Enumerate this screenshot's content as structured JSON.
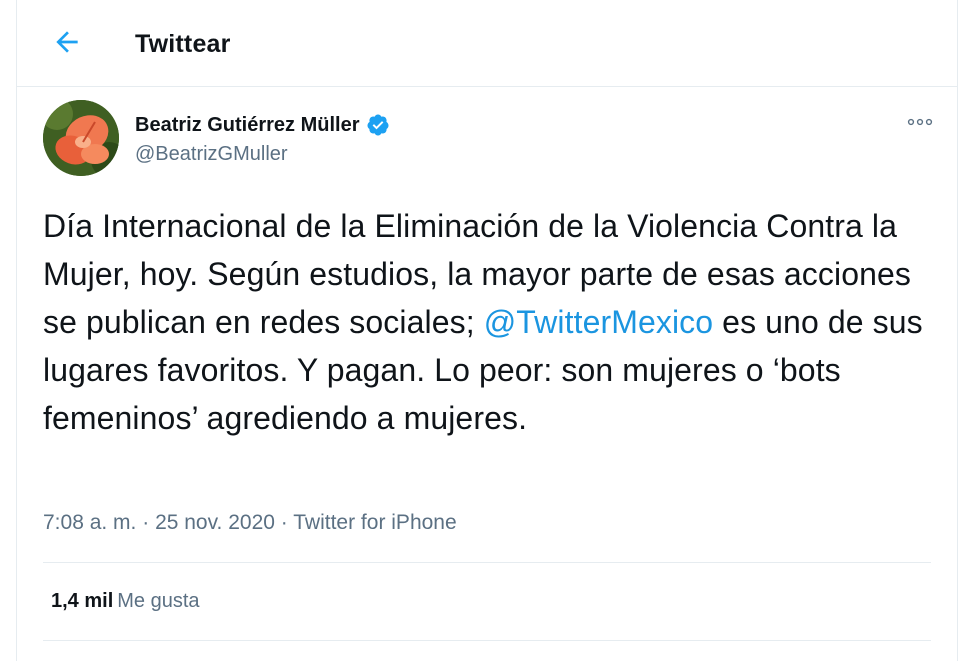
{
  "header": {
    "title": "Twittear",
    "back_icon": "arrow-left-icon"
  },
  "colors": {
    "accent": "#1b95e0",
    "text": "#0f1419",
    "muted": "#5b7083",
    "border": "#e6ecf0",
    "verified": "#1da1f2"
  },
  "tweet": {
    "author": {
      "name": "Beatriz Gutiérrez Müller",
      "handle": "@BeatrizGMuller",
      "verified_icon": "verified-badge-icon"
    },
    "text_part1": "Día Internacional de la Eliminación de la Violencia Contra la Mujer, hoy. Según estudios, la mayor parte de esas acciones se publican en redes sociales; ",
    "mention": "@TwitterMexico",
    "text_part2": " es uno de sus lugares favoritos. Y pagan. Lo peor: son mujeres o ‘bots femeninos’ agrediendo a mujeres.",
    "time": "7:08 a. m.",
    "dot1": " · ",
    "date": "25 nov. 2020",
    "dot2": " · ",
    "source": "Twitter for iPhone",
    "likes_count": "1,4 mil",
    "likes_label": "Me gusta",
    "more_icon": "more-options-icon"
  }
}
